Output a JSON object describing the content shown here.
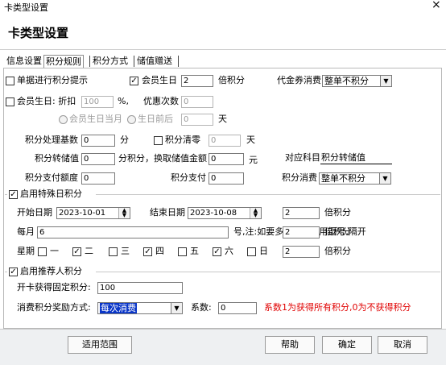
{
  "window": {
    "title": "卡类型设置",
    "close": "×"
  },
  "header": {
    "title": "卡类型设置"
  },
  "tabs": [
    {
      "label": "信息设置"
    },
    {
      "label": "积分规则"
    },
    {
      "label": "积分方式"
    },
    {
      "label": "储值赠送"
    }
  ],
  "row1": {
    "tip_label": "单据进行积分提示",
    "birthday_label": "会员生日",
    "birthday_multiplier": "2",
    "multiplier_unit": "倍积分",
    "voucher_label": "代金券消费",
    "voucher_value": "整单不积分"
  },
  "row2": {
    "birthday_discount_label": "会员生日: 折扣",
    "discount_value": "100",
    "percent": "%,",
    "discount_times_label": "优惠次数",
    "discount_times_value": "0"
  },
  "row3": {
    "month_label": "会员生日当月",
    "before_label": "生日前后",
    "before_value": "0",
    "days_unit": "天"
  },
  "row4": {
    "base_label": "积分处理基数",
    "base_value": "0",
    "base_unit": "分",
    "clear_label": "积分清零",
    "clear_value": "0",
    "clear_unit": "天"
  },
  "row5": {
    "convert_label": "积分转储值",
    "convert_value": "0",
    "convert_mid": "分积分，换取储值金额",
    "amount_value": "0",
    "amount_unit": "元",
    "subject_label": "对应科目",
    "subject_value": "积分转储值"
  },
  "row6": {
    "quota_label": "积分支付额度",
    "quota_value": "0",
    "pay_label": "积分支付",
    "pay_value": "0",
    "consume_label": "积分消费",
    "consume_value": "整单不积分"
  },
  "special": {
    "enable_label": "启用特殊日积分",
    "start_label": "开始日期",
    "start_value": "2023-10-01",
    "end_label": "结束日期",
    "end_value": "2023-10-08",
    "date_multiplier": "2",
    "monthly_label": "每月",
    "monthly_value": "6",
    "monthly_note": "号,注:如要多个天数请用逗号,隔开",
    "monthly_multiplier": "2",
    "week_label": "星期",
    "weekdays": [
      {
        "label": "一",
        "checked": false
      },
      {
        "label": "二",
        "checked": true
      },
      {
        "label": "三",
        "checked": false
      },
      {
        "label": "四",
        "checked": true
      },
      {
        "label": "五",
        "checked": false
      },
      {
        "label": "六",
        "checked": true
      },
      {
        "label": "日",
        "checked": false
      }
    ],
    "week_multiplier": "2",
    "multiplier_unit": "倍积分"
  },
  "referral": {
    "enable_label": "启用推荐人积分",
    "fixed_label": "开卡获得固定积分:",
    "fixed_value": "100",
    "mode_label": "消费积分奖励方式:",
    "mode_value": "每次消费",
    "coef_label": "系数:",
    "coef_value": "0",
    "note": "系数1为获得所有积分,0为不获得积分"
  },
  "footer": {
    "scope_button": "适用范围",
    "help_button": "帮助",
    "ok_button": "确定",
    "cancel_button": "取消"
  },
  "check": "✓"
}
